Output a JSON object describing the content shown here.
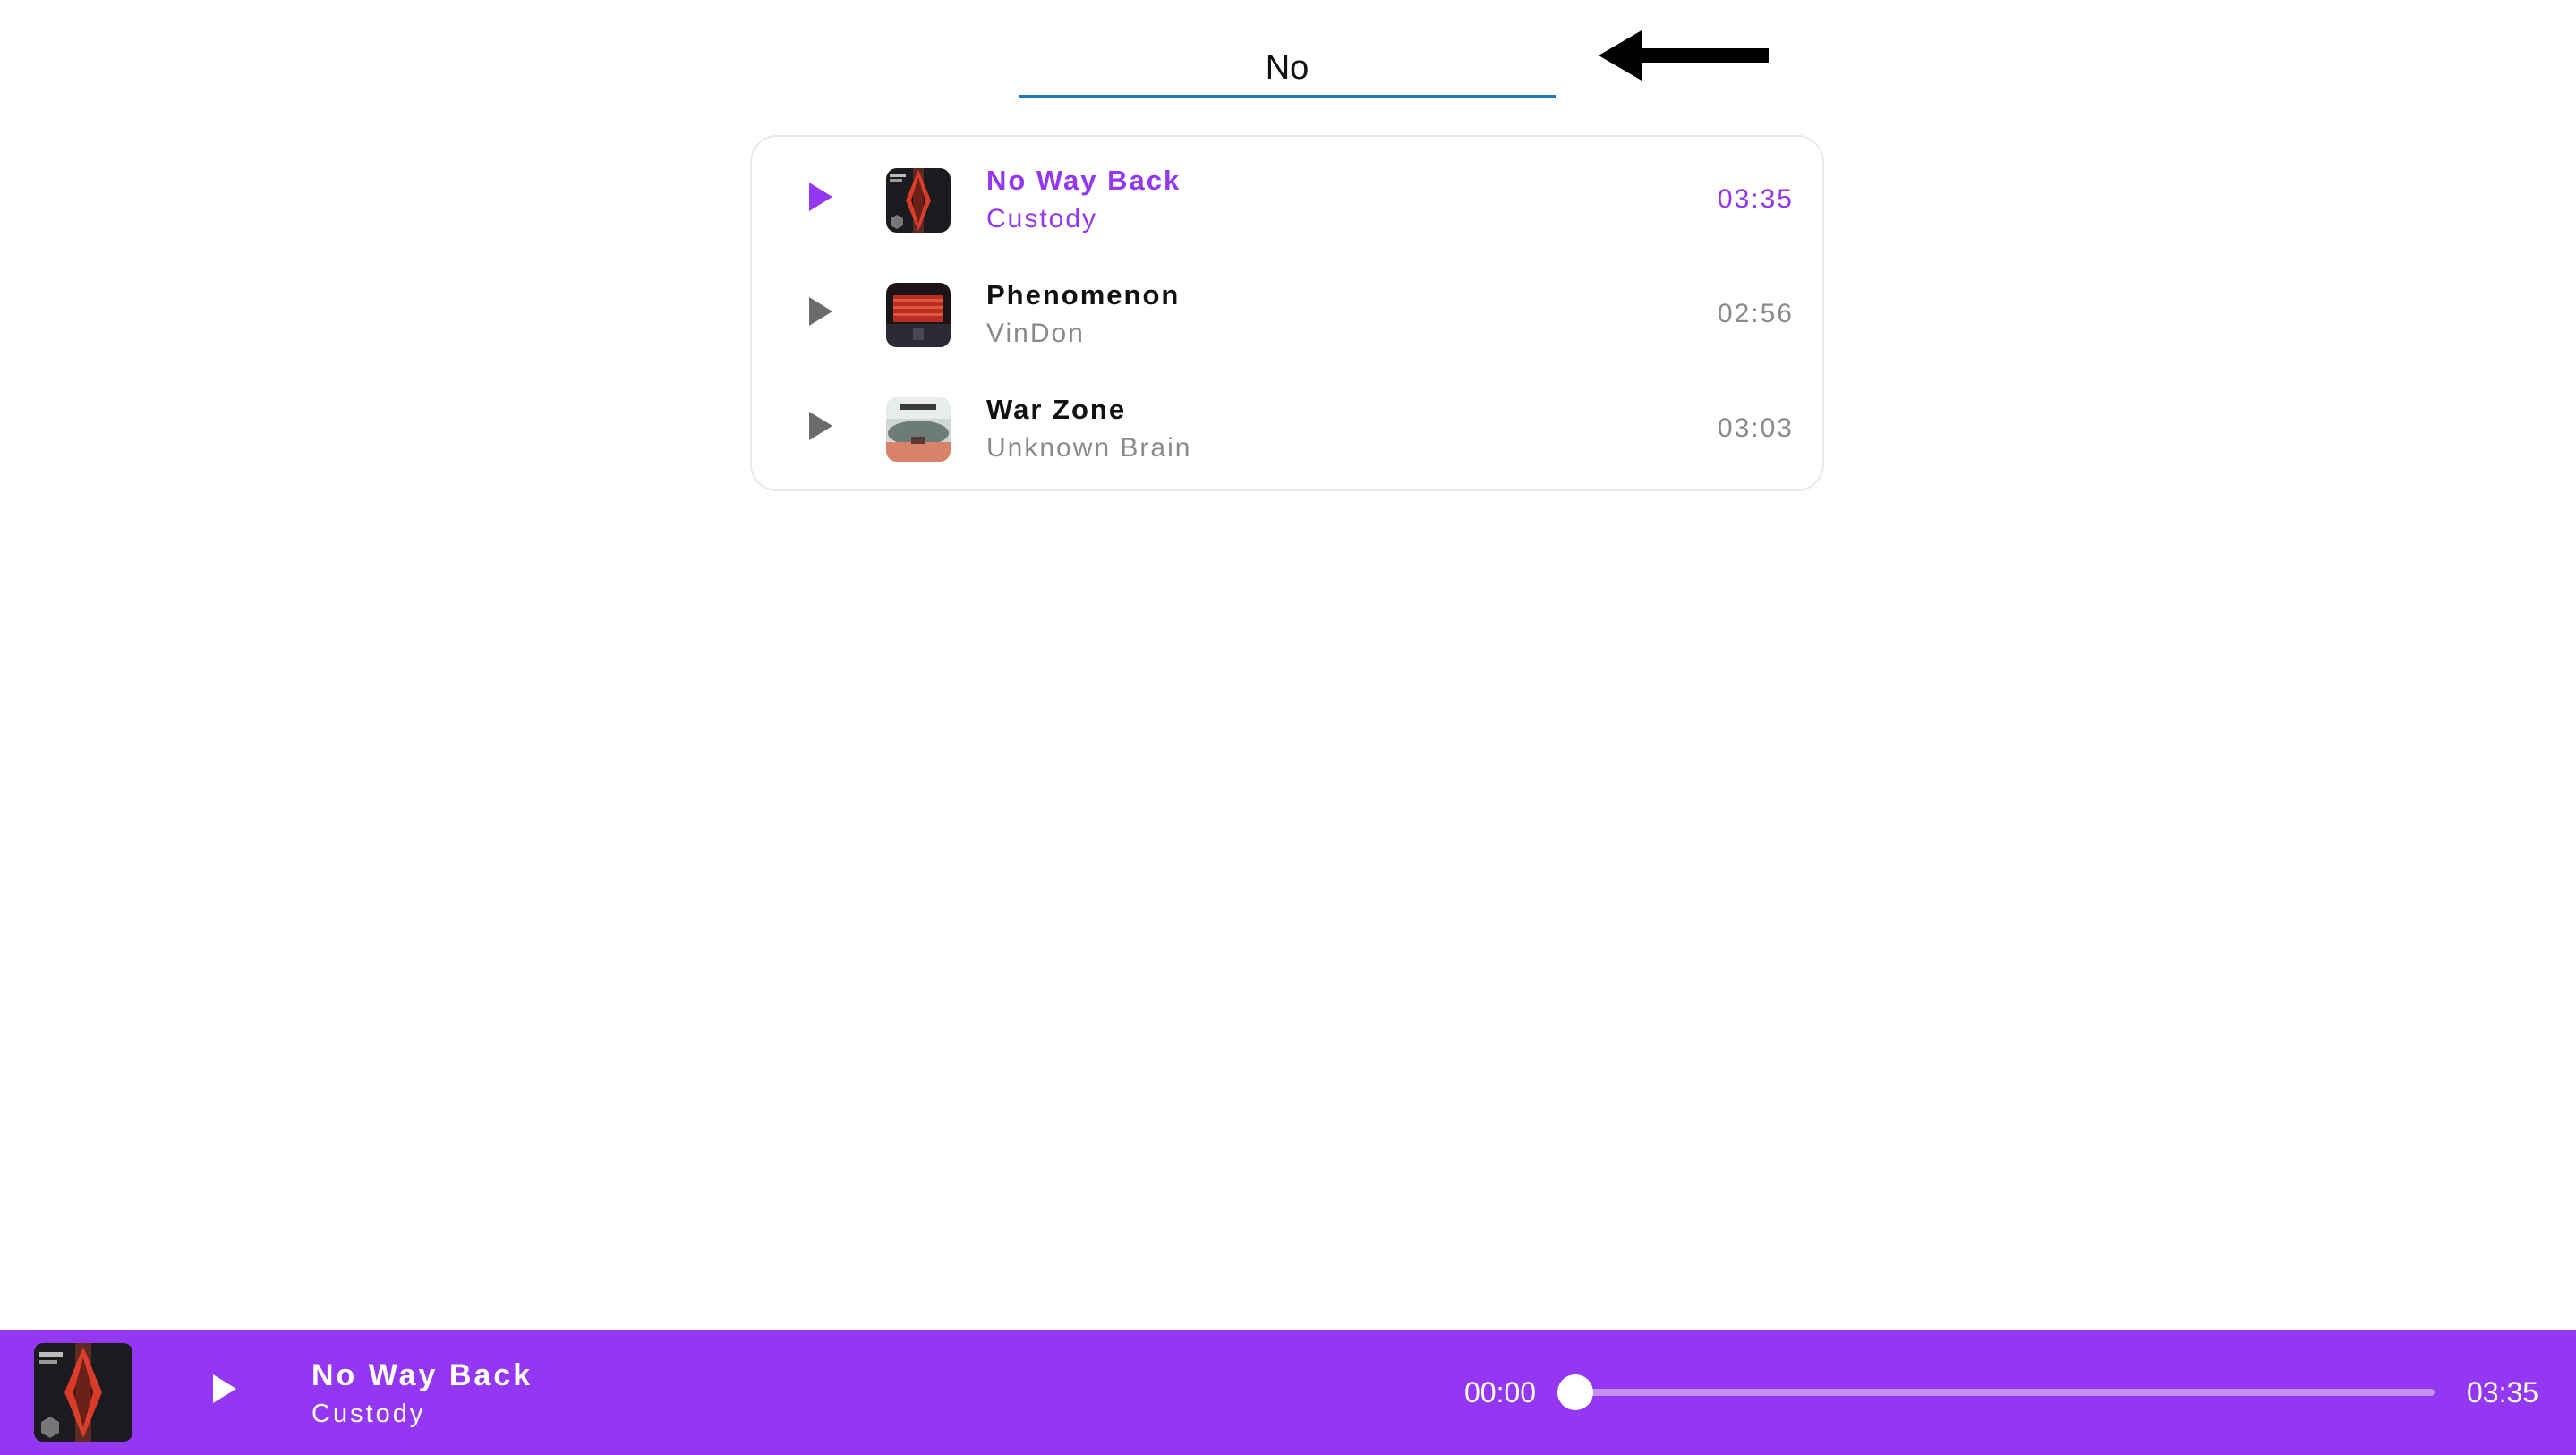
{
  "search": {
    "value": "No",
    "accent_color": "#1e79c4"
  },
  "annotation": {
    "icon": "left-arrow-icon"
  },
  "tracks": [
    {
      "title": "No Way Back",
      "artist": "Custody",
      "duration": "03:35",
      "active": true
    },
    {
      "title": "Phenomenon",
      "artist": "VinDon",
      "duration": "02:56",
      "active": false
    },
    {
      "title": "War Zone",
      "artist": "Unknown Brain",
      "duration": "03:03",
      "active": false
    }
  ],
  "player": {
    "title": "No Way Back",
    "artist": "Custody",
    "current_time": "00:00",
    "total_time": "03:35",
    "progress": 0,
    "background": "#9337f2"
  },
  "colors": {
    "accent": "#9337f2",
    "muted_text": "#8a8a8a",
    "play_icon_inactive": "#6b6b6b"
  }
}
